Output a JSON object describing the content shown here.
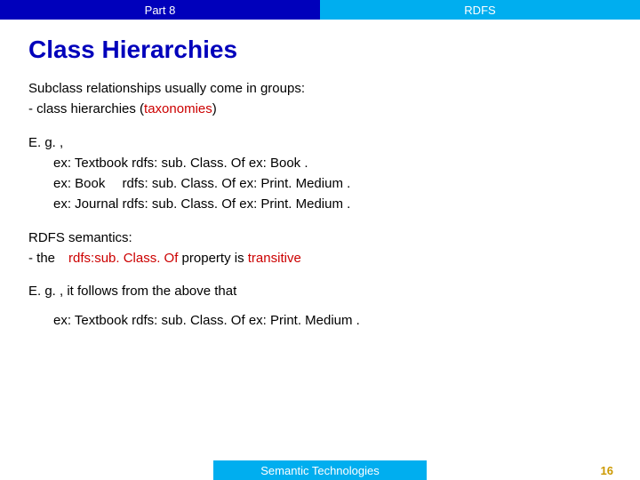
{
  "header": {
    "left": "Part 8",
    "right": "RDFS"
  },
  "title": "Class Hierarchies",
  "p1_line1": "Subclass relationships usually come in groups:",
  "p1_line2_a": " - class hierarchies (",
  "p1_line2_b": "taxonomies",
  "p1_line2_c": ")",
  "p2_lead": "E. g. ,",
  "p2_l1": "ex: Textbook rdfs: sub. Class. Of ex: Book .",
  "p2_l2": "ex: Book  rdfs: sub. Class. Of ex: Print. Medium .",
  "p2_l3": "ex: Journal  rdfs: sub. Class. Of ex: Print. Medium .",
  "p3_line1": "RDFS semantics:",
  "p3_line2_a": " - the ",
  "p3_line2_b": "rdfs:sub. Class. Of",
  "p3_line2_c": "   property is ",
  "p3_line2_d": "transitive",
  "p4_lead": "E. g. , it follows from the above that",
  "p4_l1": "ex: Textbook rdfs: sub. Class. Of ex: Print. Medium .",
  "footer": {
    "center": "Semantic Technologies",
    "page": "16"
  }
}
